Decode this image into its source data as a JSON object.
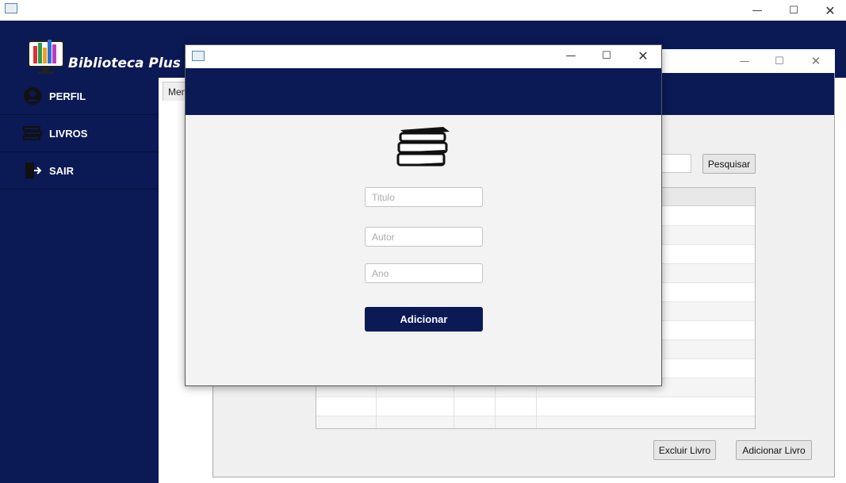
{
  "app": {
    "title": "Biblioteca Plus",
    "accent_color": "#0b1955"
  },
  "sidebar": {
    "items": [
      {
        "label": "PERFIL",
        "icon": "user-circle-icon"
      },
      {
        "label": "LIVROS",
        "icon": "books-icon"
      },
      {
        "label": "SAIR",
        "icon": "exit-door-icon"
      }
    ]
  },
  "main_tabs": [
    {
      "label": "Menu"
    }
  ],
  "books_window": {
    "search_button": "Pesquisar",
    "delete_button": "Excluir Livro",
    "add_button": "Adicionar Livro",
    "table_rows": 12
  },
  "dialog": {
    "icon": "book-stack-icon",
    "fields": {
      "title_placeholder": "Titulo",
      "author_placeholder": "Autor",
      "year_placeholder": "Ano"
    },
    "submit_label": "Adicionar"
  }
}
